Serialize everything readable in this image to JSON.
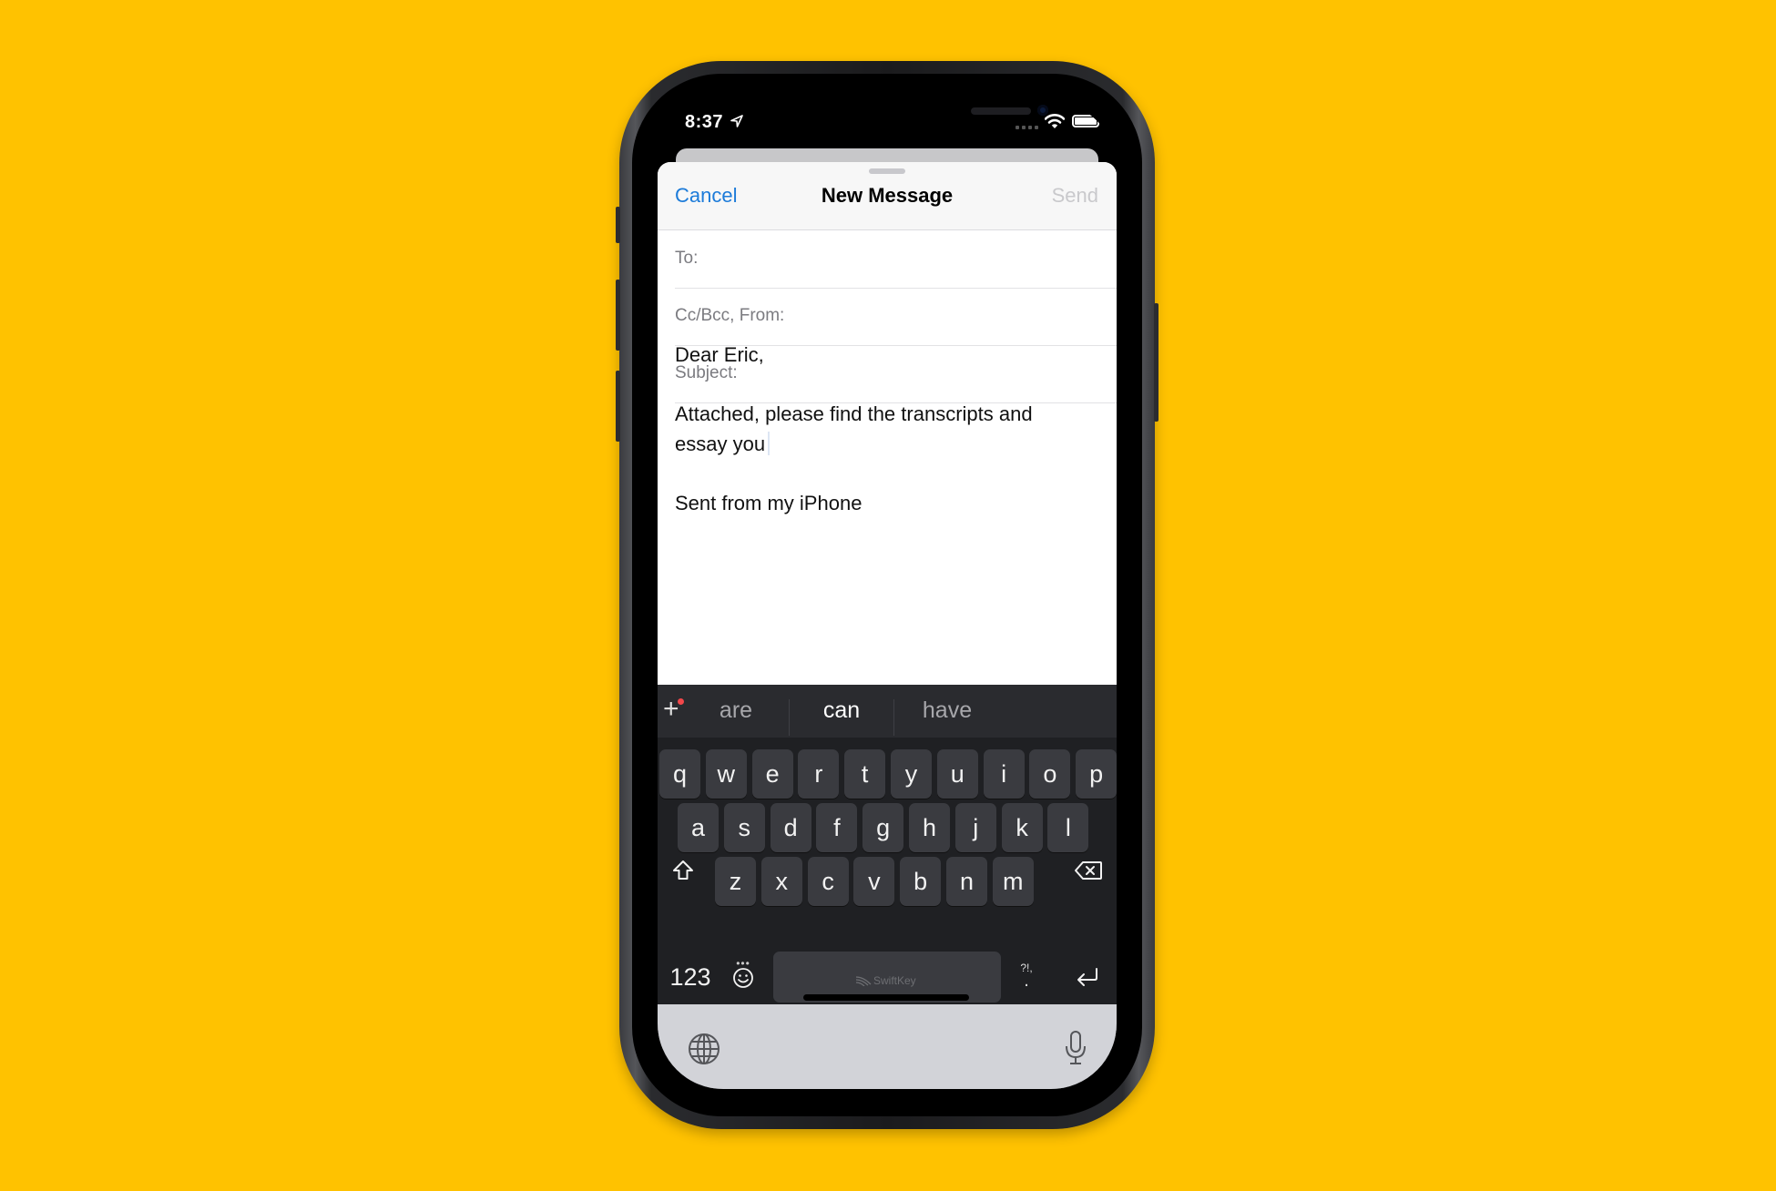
{
  "status_bar": {
    "time": "8:37",
    "icons": [
      "location-arrow-icon",
      "cellular-signal-icon",
      "wifi-icon",
      "battery-icon"
    ]
  },
  "compose": {
    "nav": {
      "cancel_label": "Cancel",
      "title": "New Message",
      "send_label": "Send"
    },
    "fields": [
      {
        "label": "To:",
        "value": ""
      },
      {
        "label": "Cc/Bcc, From:",
        "value": ""
      },
      {
        "label": "Subject:",
        "value": ""
      }
    ],
    "body_lines": [
      "Dear Eric,",
      "",
      "Attached, please find the transcripts and",
      "essay you",
      "",
      "Sent from my iPhone"
    ]
  },
  "keyboard": {
    "brand": "SwiftKey",
    "suggestions": [
      "are",
      "can",
      "have"
    ],
    "rows": [
      [
        "q",
        "w",
        "e",
        "r",
        "t",
        "y",
        "u",
        "i",
        "o",
        "p"
      ],
      [
        "a",
        "s",
        "d",
        "f",
        "g",
        "h",
        "j",
        "k",
        "l"
      ],
      [
        "z",
        "x",
        "c",
        "v",
        "b",
        "n",
        "m"
      ]
    ],
    "numbers_label": "123",
    "punctuation_label": "?!,",
    "icons": {
      "add": "plus-icon",
      "shift": "shift-icon",
      "backspace": "backspace-icon",
      "emoji": "emoji-icon",
      "return": "return-icon",
      "globe": "globe-icon",
      "mic": "microphone-icon"
    }
  },
  "colors": {
    "background": "#FFC200",
    "accent": "#1C7BD9",
    "keyboard_bg": "#1F2023",
    "key_bg": "#3A3B40"
  }
}
